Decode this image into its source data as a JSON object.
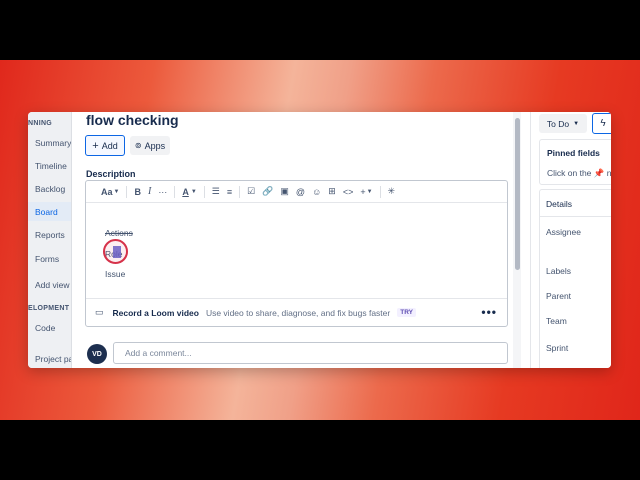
{
  "colors": {
    "accent": "#0c66e4",
    "text": "#172b4d",
    "muted": "#44546f",
    "cursor_ring": "#d6324a"
  },
  "sidebar": {
    "section_planning": "NNING",
    "items": [
      {
        "label": "Summary"
      },
      {
        "label": "Timeline"
      },
      {
        "label": "Backlog"
      },
      {
        "label": "Board",
        "active": true
      },
      {
        "label": "Reports"
      },
      {
        "label": "Forms"
      },
      {
        "label": "Add view"
      }
    ],
    "section_development": "ELOPMENT",
    "dev_items": [
      {
        "label": "Code"
      }
    ],
    "project_pages": "Project pag"
  },
  "issue": {
    "title": "flow checking",
    "add_label": "Add",
    "apps_label": "Apps",
    "description_label": "Description"
  },
  "editor": {
    "toolbar": {
      "text_style": "Aa",
      "bold": "B",
      "italic": "I",
      "more": "···",
      "text_color": "A"
    },
    "lines": {
      "actions": "Actions",
      "role": "Role",
      "issue": "Issue"
    },
    "loom": {
      "title": "Record a Loom video",
      "subtitle": "Use video to share, diagnose, and fix bugs faster",
      "badge": "TRY"
    }
  },
  "comment": {
    "avatar_initials": "VD",
    "placeholder": "Add a comment..."
  },
  "right_panel": {
    "status": "To Do",
    "pinned_title": "Pinned fields",
    "pinned_hint": "Click on the 📌 nex",
    "details_title": "Details",
    "fields": [
      {
        "label": "Assignee"
      },
      {
        "label": "Labels"
      },
      {
        "label": "Parent"
      },
      {
        "label": "Team"
      },
      {
        "label": "Sprint"
      }
    ]
  }
}
